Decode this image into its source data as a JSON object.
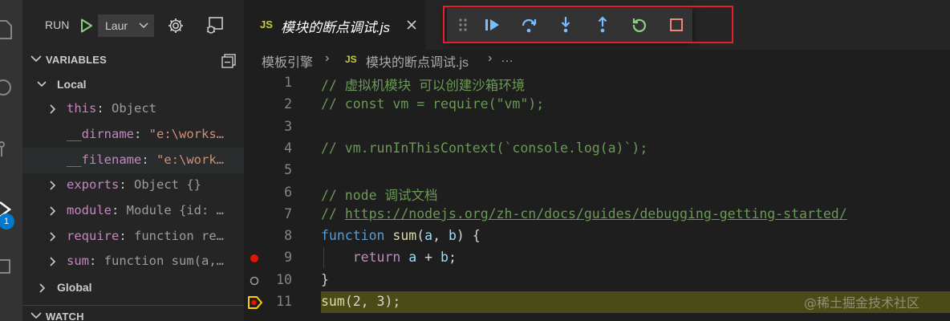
{
  "activity_bar": {
    "icons": [
      "explorer-icon",
      "search-icon",
      "source-control-icon",
      "run-debug-icon",
      "extensions-icon"
    ],
    "debug_badge": "1"
  },
  "run": {
    "label": "RUN",
    "config": "Laur"
  },
  "variables": {
    "title": "VARIABLES",
    "local_label": "Local",
    "global_label": "Global",
    "items": [
      {
        "name": "this",
        "value": "Object"
      },
      {
        "name": "__dirname",
        "value": "\"e:\\works…"
      },
      {
        "name": "__filename",
        "value": "\"e:\\work…"
      },
      {
        "name": "exports",
        "value": "Object {}"
      },
      {
        "name": "module",
        "value": "Module {id: …"
      },
      {
        "name": "require",
        "value": "function re…"
      },
      {
        "name": "sum",
        "value": "function sum(a,…"
      }
    ]
  },
  "watch": {
    "title": "WATCH"
  },
  "tab": {
    "lang": "JS",
    "filename": "模块的断点调试.js"
  },
  "breadcrumb": {
    "folder": "模板引擎",
    "sep": "›",
    "lang": "JS",
    "file": "模块的断点调试.js",
    "tail": "…"
  },
  "debug_toolbar": {
    "buttons": [
      "continue",
      "step-over",
      "step-into",
      "step-out",
      "restart",
      "stop"
    ]
  },
  "code": {
    "line_numbers": [
      "1",
      "2",
      "3",
      "4",
      "5",
      "6",
      "7",
      "8",
      "9",
      "10",
      "11"
    ],
    "l1": "// 虚拟机模块 可以创建沙箱环境",
    "l2": "// const vm = require(\"vm\");",
    "l4": "// vm.runInThisContext(`console.log(a)`);",
    "l6": "// node 调试文档",
    "l7_prefix": "// ",
    "l7_link": "https://nodejs.org/zh-cn/docs/guides/debugging-getting-started/",
    "l8_kw": "function",
    "l8_fn": "sum",
    "l8_p1": "(",
    "l8_a": "a",
    "l8_c": ", ",
    "l8_b": "b",
    "l8_end": ") {",
    "l9_kw": "return",
    "l9_a": "a",
    "l9_op": " + ",
    "l9_b": "b",
    "l9_end": ";",
    "l10": "}",
    "l11_fn": "sum",
    "l11_rest": "(2, 3);"
  },
  "watermark": "@稀土掘金技术社区",
  "colors": {
    "accent": "#007acc",
    "highlight_border": "#e81c2f",
    "breakpoint": "#e51400",
    "current_line": "#4b4b18"
  }
}
